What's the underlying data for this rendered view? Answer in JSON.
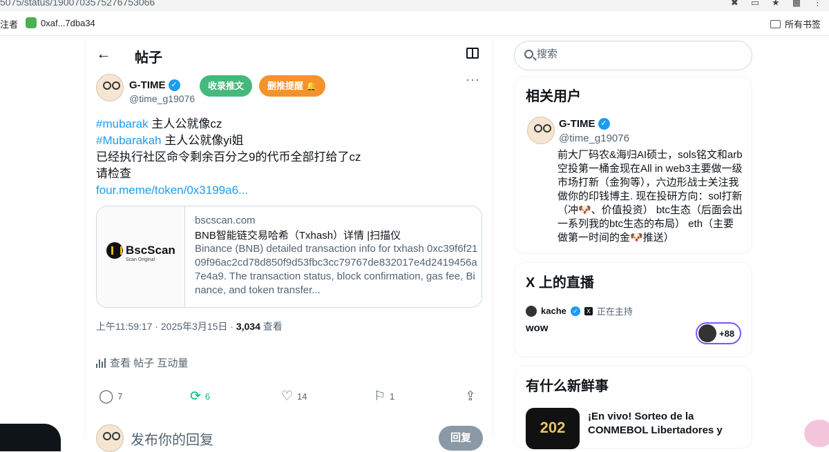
{
  "browser": {
    "url": "5075/status/1900703575276753066",
    "bookmarks": [
      {
        "label": "注者"
      },
      {
        "label": "0xaf...7dba34"
      }
    ],
    "all_bookmarks": "所有书签"
  },
  "header": {
    "title": "帖子"
  },
  "post": {
    "author": "G-TIME",
    "handle": "@time_g19076",
    "btn_collect": "收录推文",
    "btn_delete_alert": "删推提醒",
    "lines": {
      "l1_tag": "#mubarak",
      "l1_text": " 主人公就像cz",
      "l2_tag": "#Mubarakah",
      "l2_text": " 主人公就像yi姐",
      "l3": "已经执行社区命令剩余百分之9的代币全部打给了cz",
      "l4": "请检查",
      "link": "four.meme/token/0x3199a6..."
    },
    "card": {
      "logo": "BscScan",
      "logo_sub": "Scan Original",
      "domain": "bscscan.com",
      "title": "BNB智能链交易哈希（Txhash）详情 |扫描仪",
      "desc": "Binance (BNB) detailed transaction info for txhash 0xc39f6f2109f96ac2cd78d850f9d53fbc3cc79767de832017e4d2419456a7e4a9. The transaction status, block confirmation, gas fee, Binance, and token transfer..."
    },
    "meta_time": "上午11:59:17 · 2025年3月15日 · ",
    "meta_views": "3,034",
    "meta_views_label": " 查看",
    "engagement_label": "查看 帖子 互动量",
    "actions": {
      "replies": "7",
      "reposts": "6",
      "likes": "14",
      "bookmarks": "1"
    },
    "reply_placeholder": "发布你的回复",
    "reply_button": "回复"
  },
  "sidebar": {
    "search_placeholder": "搜索",
    "related": {
      "title": "相关用户",
      "name": "G-TIME",
      "handle": "@time_g19076",
      "bio": "前大厂码农&海归AI硕士，sols铭文和arb空投第一桶金现在All in web3主要做一级市场打新（金狗等），六边形战士关注我做你的印钱博主. 现在投研方向：sol打新（冲🐶、价值投资） btc生态（后面会出一系列我的btc生态的布局） eth（主要做第一时间的金🐶推送）"
    },
    "live": {
      "title": "X 上的直播",
      "host": "kache",
      "status": "正在主持",
      "stream_title": "wow",
      "listeners": "+88"
    },
    "news": {
      "title": "有什么新鲜事",
      "headline": "¡En vivo! Sorteo de la CONMEBOL Libertadores y",
      "thumb": "202"
    }
  }
}
